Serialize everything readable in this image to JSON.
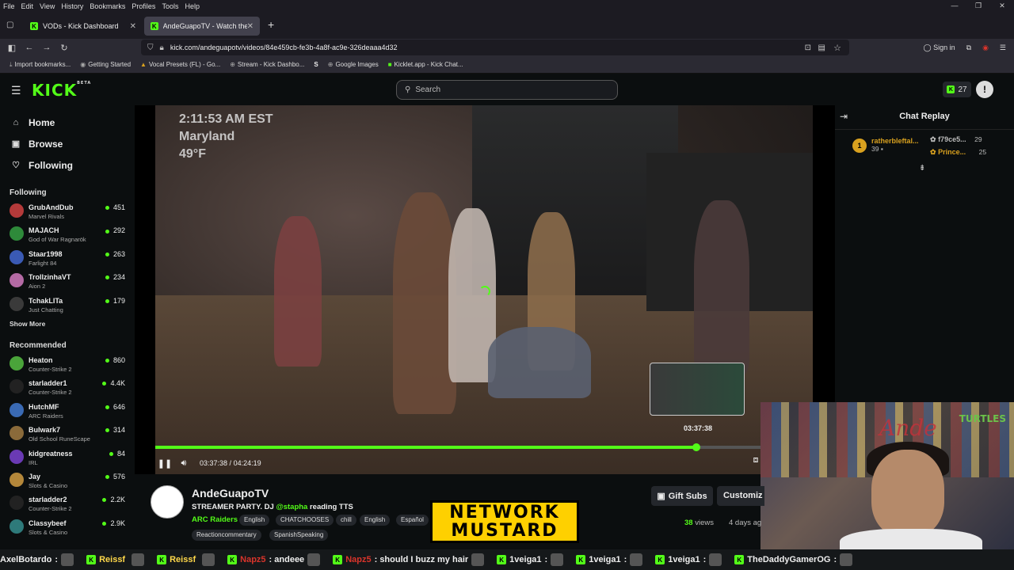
{
  "browser": {
    "menu": [
      "File",
      "Edit",
      "View",
      "History",
      "Bookmarks",
      "Profiles",
      "Tools",
      "Help"
    ],
    "tabs": [
      {
        "label": "VODs - Kick Dashboard"
      },
      {
        "label": "AndeGuapoTV - Watch the VOD"
      }
    ],
    "new_tab": "+",
    "url": "kick.com/andeguapotv/videos/84e459cb-fe3b-4a8f-ac9e-326deaaa4d32",
    "sign_in": "Sign in",
    "bookmarks": [
      "Import bookmarks...",
      "Getting Started",
      "Vocal Presets (FL) - Go...",
      "Stream - Kick Dashbo...",
      "Google Images",
      "Kicklet.app - Kick Chat..."
    ]
  },
  "header": {
    "logo": "KICK",
    "logo_badge": "BETA",
    "search_placeholder": "Search",
    "points": "27",
    "avatar_glyph": "!"
  },
  "sidebar": {
    "nav": [
      {
        "label": "Home"
      },
      {
        "label": "Browse"
      },
      {
        "label": "Following"
      }
    ],
    "following_title": "Following",
    "following": [
      {
        "name": "GrubAndDub",
        "game": "Marvel Rivals",
        "viewers": "451",
        "color": "#b43a3a"
      },
      {
        "name": "MAJACH",
        "game": "God of War Ragnarök",
        "viewers": "292",
        "color": "#2e8a3a"
      },
      {
        "name": "Staar1998",
        "game": "Farlight 84",
        "viewers": "263",
        "color": "#3a5ab4"
      },
      {
        "name": "TrollzinhaVT",
        "game": "Aion 2",
        "viewers": "234",
        "color": "#b46aa4"
      },
      {
        "name": "TchakLITa",
        "game": "Just Chatting",
        "viewers": "179",
        "color": "#3a3a3a"
      }
    ],
    "show_more": "Show More",
    "recommended_title": "Recommended",
    "recommended": [
      {
        "name": "Heaton",
        "game": "Counter-Strike 2",
        "viewers": "860",
        "color": "#4aa43a"
      },
      {
        "name": "starladder1",
        "game": "Counter-Strike 2",
        "viewers": "4.4K",
        "color": "#222"
      },
      {
        "name": "HutchMF",
        "game": "ARC Raiders",
        "viewers": "646",
        "color": "#3a6ab4"
      },
      {
        "name": "Bulwark7",
        "game": "Old School RuneScape",
        "viewers": "314",
        "color": "#8a6a3a"
      },
      {
        "name": "kidgreatness",
        "game": "IRL",
        "viewers": "84",
        "color": "#6a3ab4"
      },
      {
        "name": "Jay",
        "game": "Slots & Casino",
        "viewers": "576",
        "color": "#b4873a"
      },
      {
        "name": "starladder2",
        "game": "Counter-Strike 2",
        "viewers": "2.2K",
        "color": "#222"
      },
      {
        "name": "Classybeef",
        "game": "Slots & Casino",
        "viewers": "2.9K",
        "color": "#2e7a7a"
      }
    ]
  },
  "player": {
    "overlay_time": "2:11:53 AM EST",
    "overlay_loc": "Maryland",
    "overlay_temp": "49°F",
    "hover_time": "03:37:38",
    "current_time": "03:37:38",
    "duration": "04:24:19",
    "progress": 0.8234
  },
  "chat": {
    "title": "Chat Replay",
    "gifters": [
      {
        "name": "ratherbleftal...",
        "count": "39",
        "color": "#d9a11f"
      },
      {
        "name": "f79ce5...",
        "count": "29",
        "color": "#bbbbbb"
      },
      {
        "name": "Prince...",
        "count": "25",
        "color": "#d9a11f"
      }
    ],
    "rank_badge": "1"
  },
  "stream": {
    "name": "AndeGuapoTV",
    "title_prefix": "STREAMER PARTY. DJ",
    "title_mention": "@stapha",
    "title_suffix": "reading TTS",
    "category": "ARC Raiders",
    "tags": [
      "English",
      "CHATCHOOSES",
      "chill",
      "English",
      "Español",
      "Reactioncommentary",
      "SpanishSpeaking"
    ],
    "gift_subs": "Gift Subs",
    "customize": "Customiz",
    "views_count": "38",
    "views_label": "views",
    "ago": "4 days ag"
  },
  "overlay_logo": {
    "line1": "NETWORK",
    "line2": "MUSTARD"
  },
  "ticker": [
    {
      "user": "AxelBotardo",
      "text": ":"
    },
    {
      "user": "Reissf",
      "text": ""
    },
    {
      "user": "Reissf",
      "text": ""
    },
    {
      "user": "Napz5",
      "text": ": andeee"
    },
    {
      "user": "Napz5",
      "text": ": should I buzz my hair"
    },
    {
      "user": "1veiga1",
      "text": ":"
    },
    {
      "user": "1veiga1",
      "text": ":"
    },
    {
      "user": "1veiga1",
      "text": ":"
    },
    {
      "user": "TheDaddyGamerOG",
      "text": ":"
    }
  ]
}
